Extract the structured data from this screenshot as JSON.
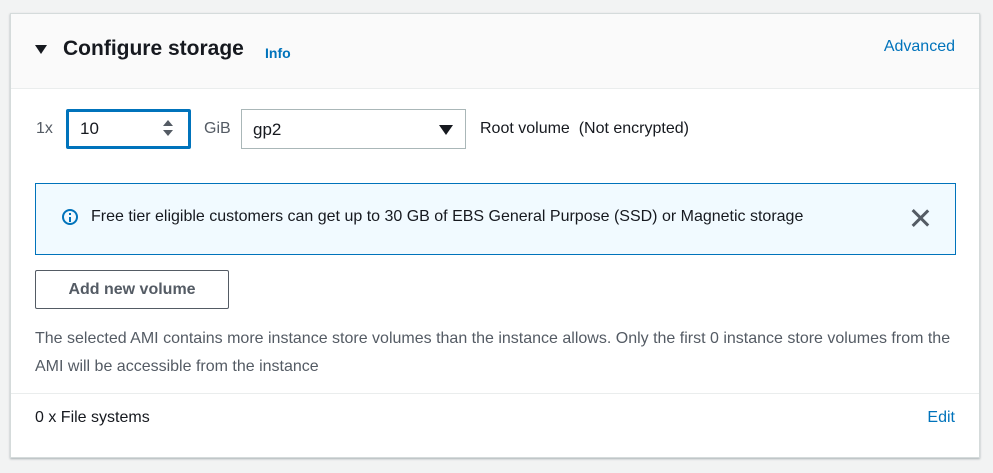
{
  "header": {
    "title": "Configure storage",
    "info_label": "Info",
    "advanced_label": "Advanced"
  },
  "volume_row": {
    "count_label": "1x",
    "size_value": "10",
    "unit_label": "GiB",
    "volume_type": "gp2",
    "description": "Root volume  (Not encrypted)"
  },
  "alert": {
    "message": "Free tier eligible customers can get up to 30 GB of EBS General Purpose (SSD) or Magnetic storage"
  },
  "add_volume_label": "Add new volume",
  "note": "The selected AMI contains more instance store volumes than the instance allows. Only the first 0 instance store volumes from the AMI will be accessible from the instance",
  "file_systems": {
    "label": "0 x File systems",
    "edit_label": "Edit"
  },
  "colors": {
    "link": "#0073bb",
    "alert_bg": "#f1faff",
    "text": "#16191f",
    "muted": "#545b64"
  },
  "icons": [
    "caret-down-icon",
    "stepper-icon",
    "dropdown-arrow-icon",
    "info-icon",
    "close-icon"
  ]
}
